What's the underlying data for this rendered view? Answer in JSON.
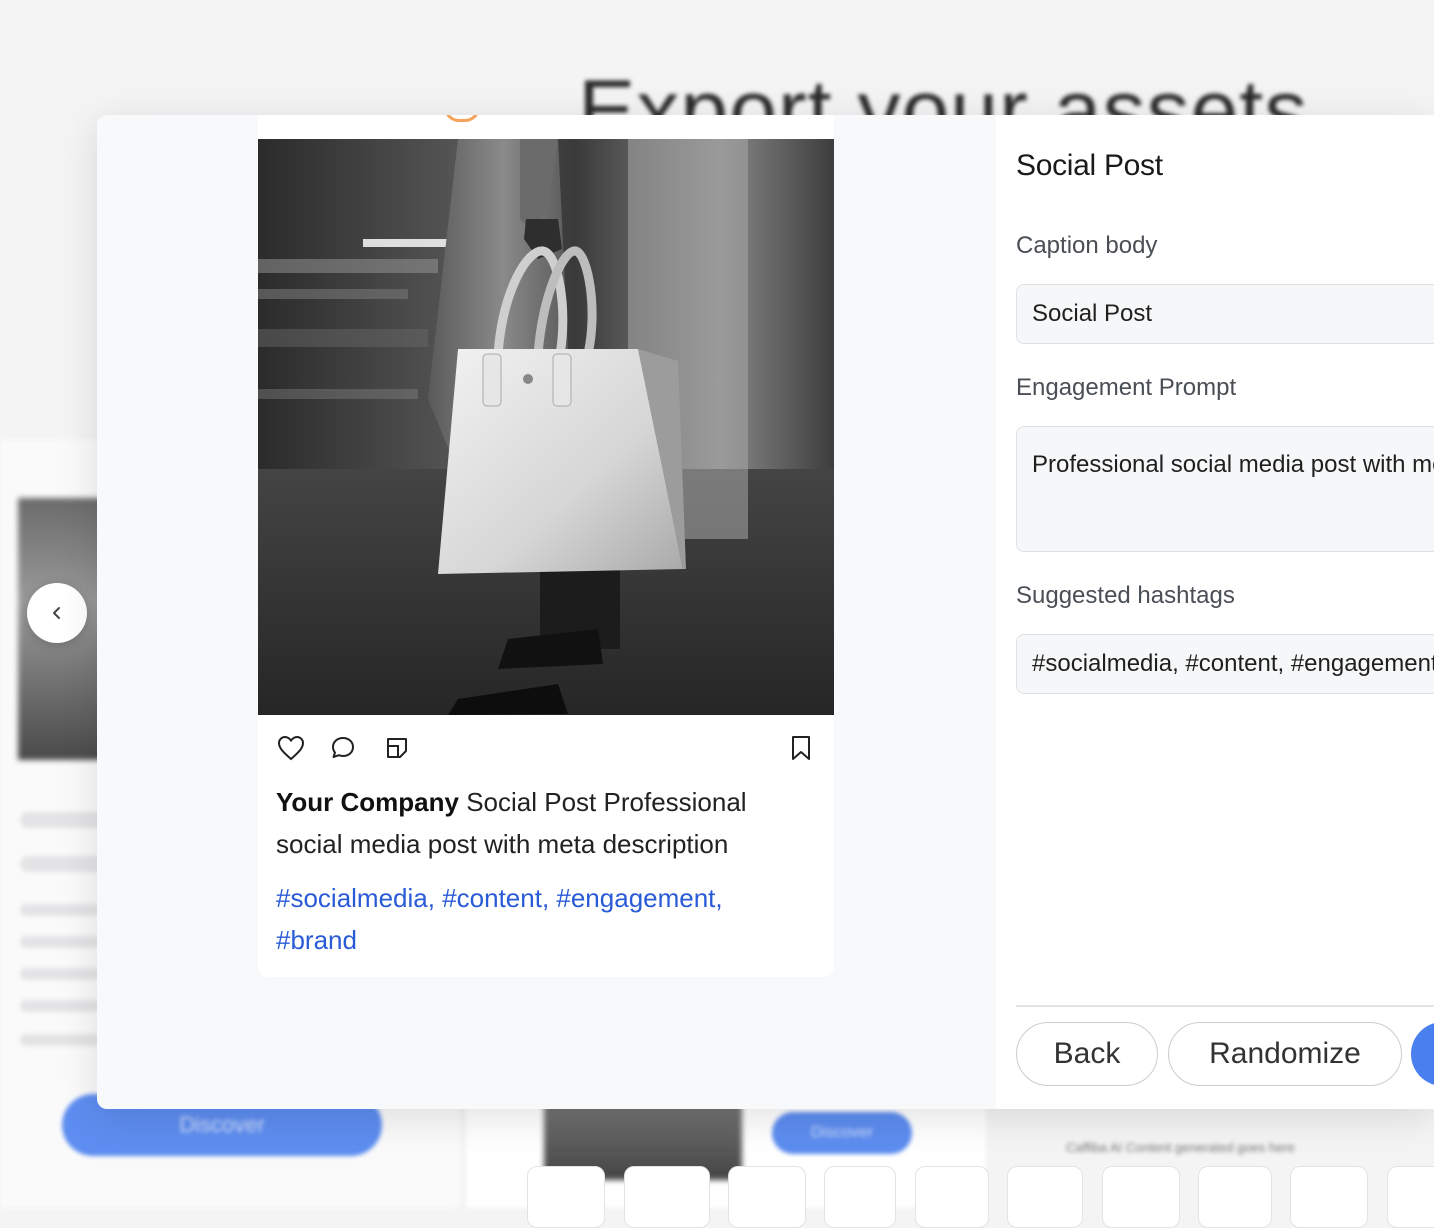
{
  "background": {
    "title": "Export your assets",
    "discover_label": "Discover",
    "discover_label_small": "Discover",
    "footer_text": "Caffiba AI Content generated goes here"
  },
  "preview": {
    "company_name": "Your Company",
    "caption_text": "Social Post Professional social media post with meta description",
    "hashtags": "#socialmedia, #content, #engagement, #brand",
    "icons": [
      "heart-icon",
      "comment-icon",
      "share-icon",
      "bookmark-icon"
    ]
  },
  "panel": {
    "title": "Social Post",
    "caption_label": "Caption body",
    "caption_value": "Social Post",
    "engagement_label": "Engagement Prompt",
    "engagement_value": "Professional social media post with meta description",
    "hashtags_label": "Suggested hashtags",
    "hashtags_value": "#socialmedia, #content, #engagement, #brand",
    "back_label": "Back",
    "randomize_label": "Randomize"
  },
  "colors": {
    "accent": "#4a7ff0",
    "hashtag": "#2a5bd7"
  }
}
